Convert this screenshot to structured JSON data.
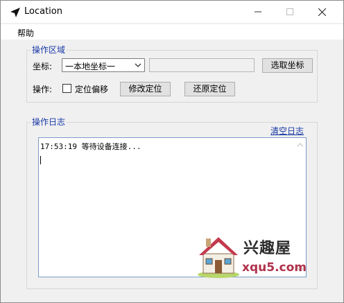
{
  "window": {
    "title": "Location"
  },
  "menu": {
    "help": "帮助"
  },
  "operation_group": {
    "legend": "操作区域",
    "coord_label": "坐标:",
    "coord_select_value": "一本地坐标一",
    "coord_input_value": "",
    "pick_coord_button": "选取坐标",
    "op_label": "操作:",
    "offset_checkbox_label": "定位偏移",
    "offset_checked": false,
    "modify_button": "修改定位",
    "restore_button": "还原定位"
  },
  "log_group": {
    "legend": "操作日志",
    "clear_link": "清空日志",
    "lines": [
      "17:53:19 等待设备连接..."
    ]
  },
  "watermark": {
    "name": "兴趣屋",
    "url": "xqu5.com"
  },
  "colors": {
    "legend_blue": "#1a3aa8",
    "window_bg": "#f0f0f0",
    "button_bg": "#e1e1e1"
  }
}
